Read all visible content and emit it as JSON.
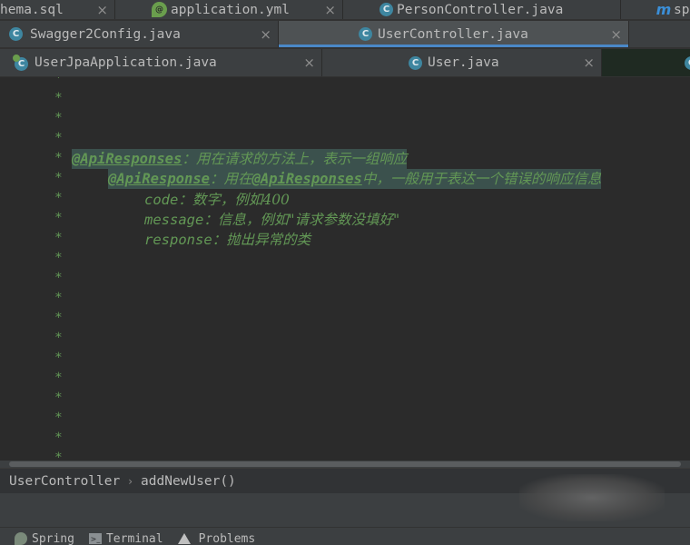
{
  "tabs": {
    "row1": [
      {
        "label": "hema.sql",
        "icon": "none"
      },
      {
        "label": "application.yml",
        "icon": "spring-yml-icon"
      },
      {
        "label": "PersonController.java",
        "icon": "class-icon"
      },
      {
        "label": "sp",
        "icon": "maven-icon",
        "icon_glyph": "m"
      }
    ],
    "row2": [
      {
        "label": "Swagger2Config.java",
        "icon": "class-icon"
      },
      {
        "label": "UserController.java",
        "icon": "class-icon",
        "active": true
      }
    ],
    "row3": [
      {
        "label": "UserJpaApplication.java",
        "icon": "spring-class-icon"
      },
      {
        "label": "User.java",
        "icon": "class-icon"
      }
    ],
    "close_glyph": "×",
    "class_glyph": "C",
    "spring_glyph": "@"
  },
  "editor": {
    "gutter_marker": "*",
    "lines": {
      "l1": {
        "kw": "@ApiResponses",
        "text": "：用在请求的方法上，表示一组响应"
      },
      "l2": {
        "kw": "@ApiResponse",
        "text_a": "：用在",
        "kw2": "@ApiResponses",
        "text_b": "中，一般用于表达一个错误的响应信息"
      },
      "l3": {
        "key": "code",
        "text": "：数字，例如400"
      },
      "l4": {
        "key": "message",
        "text": "：信息，例如\"请求参数没填好\""
      },
      "l5": {
        "key": "response",
        "text": "：抛出异常的类"
      }
    },
    "colors": {
      "comment": "#629755",
      "highlight": "#3b514d",
      "background": "#2b2b2b"
    }
  },
  "breadcrumb": {
    "items": [
      "UserController",
      "addNewUser()"
    ],
    "separator": "›"
  },
  "toolbar": {
    "items": [
      {
        "label": "Spring",
        "icon": "spring-icon"
      },
      {
        "label": "Terminal",
        "icon": "terminal-icon"
      },
      {
        "label": "Problems",
        "icon": "warning-icon"
      }
    ]
  }
}
